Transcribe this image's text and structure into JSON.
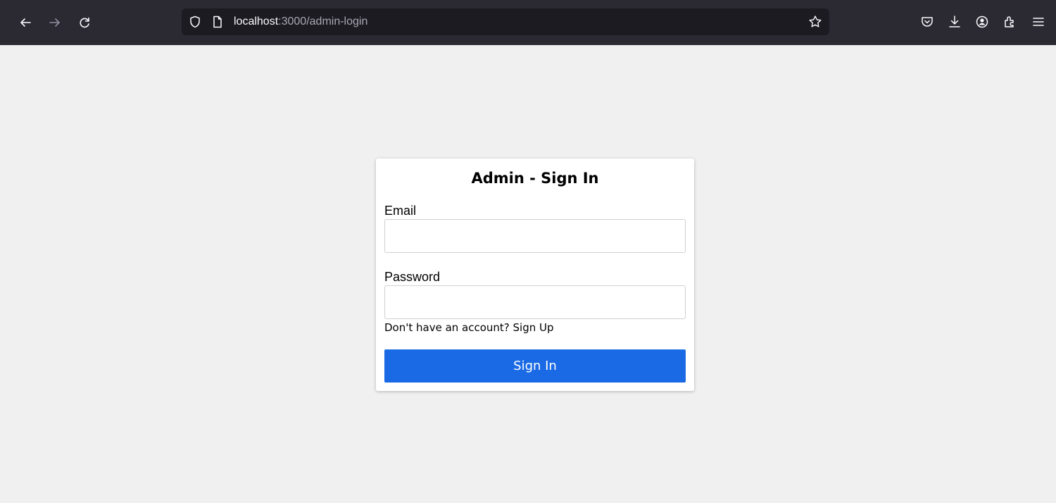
{
  "browser": {
    "url_host": "localhost",
    "url_path": ":3000/admin-login",
    "icons": [
      "back-arrow-icon",
      "forward-arrow-icon",
      "reload-icon",
      "shield-icon",
      "page-icon",
      "bookmark-star-icon",
      "pocket-icon",
      "download-icon",
      "account-icon",
      "extensions-icon",
      "menu-icon"
    ],
    "colors": {
      "toolbar_bg": "#2b2a33",
      "urlbar_bg": "#1c1b22"
    }
  },
  "login": {
    "title": "Admin - Sign In",
    "email_label": "Email",
    "email_value": "",
    "password_label": "Password",
    "password_value": "",
    "signup_prompt": "Don't have an account? Sign Up",
    "submit_label": "Sign In",
    "colors": {
      "page_bg": "#f0f0f0",
      "button_bg": "#1a6ae5",
      "card_bg": "#ffffff"
    }
  }
}
